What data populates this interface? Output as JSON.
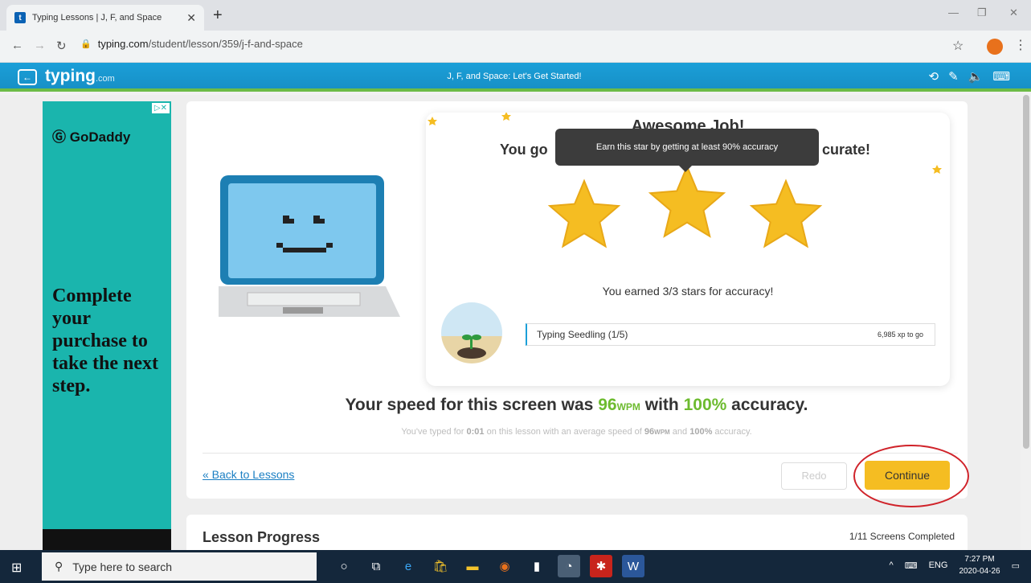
{
  "browser": {
    "tab_title": "Typing Lessons | J, F, and Space",
    "tab_favicon": "t",
    "url_domain": "typing.com",
    "url_path": "/student/lesson/359/j-f-and-space"
  },
  "site": {
    "logo": "typing",
    "logo_suffix": ".com",
    "lesson_title": "J, F, and Space: Let's Get Started!"
  },
  "ad": {
    "brand": "GoDaddy",
    "copy": "Complete your purchase to take the next step."
  },
  "result": {
    "headline": "Awesome Job!",
    "subline_left": "You go",
    "subline_right": "curate!",
    "tooltip": "Earn this star by getting at least 90% accuracy",
    "stars_earned": 3,
    "stars_total": 3,
    "earned_text": "You earned 3/3 stars for accuracy!",
    "level_name": "Typing Seedling (1/5)",
    "xp_to_go": "6,985 xp to go"
  },
  "speed": {
    "prefix": "Your speed for this screen was",
    "wpm": "96",
    "wpm_unit": "WPM",
    "middle": "with",
    "accuracy": "100%",
    "suffix": "accuracy."
  },
  "substats": {
    "p1": "You've typed for",
    "time": "0:01",
    "p2": "on this lesson with an average speed of",
    "wpm": "96",
    "wpm_unit": "WPM",
    "p3": "and",
    "accuracy": "100%",
    "p4": "accuracy."
  },
  "actions": {
    "back": "« Back to Lessons",
    "redo": "Redo",
    "continue": "Continue"
  },
  "progress": {
    "title": "Lesson Progress",
    "count": "1/11 Screens Completed"
  },
  "taskbar": {
    "search_placeholder": "Type here to search",
    "lang": "ENG",
    "time": "7:27 PM",
    "date": "2020-04-26"
  },
  "colors": {
    "accent": "#1b9fd8",
    "green": "#6dbb2f",
    "star": "#f5bd22",
    "highlight": "#d0232a"
  }
}
